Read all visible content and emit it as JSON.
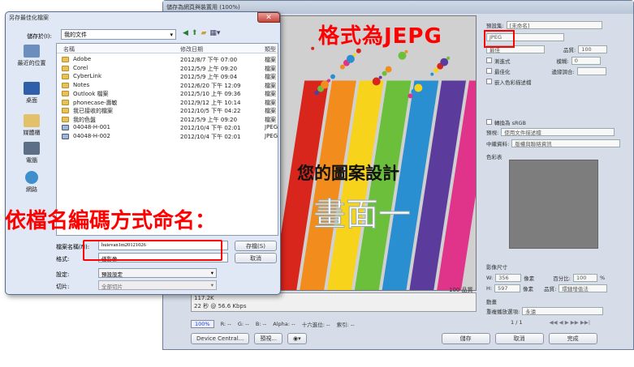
{
  "sfw_window": {
    "title": "儲存為網頁與裝置用 (100%)",
    "artwork_line1": "您的圖案設計",
    "artwork_line2": "畫面一",
    "preview_size": "100 品質",
    "info_lines": [
      "117.2K",
      "22 秒 @ 56.6 Kbps"
    ],
    "zoom": "100%",
    "status": [
      "R: --",
      "G: --",
      "B: --",
      "Alpha: --",
      "十六進位: --",
      "索引: --"
    ],
    "buttons": {
      "device_central": "Device Central...",
      "preview": "預視...",
      "save": "儲存",
      "cancel": "取消",
      "done": "完成"
    }
  },
  "panel": {
    "preset_label": "預設集:",
    "preset_value": "[未命名]",
    "format_value": "JPEG",
    "quality_mode": "最佳",
    "quality_label": "品質:",
    "quality_value": "100",
    "progressive": "漸進式",
    "blur_label": "模糊:",
    "blur_value": "0",
    "optimized": "最佳化",
    "matte_label": "邊緣調合:",
    "embed_profile": "嵌入色彩描述檔",
    "convert_srgb": "轉換為 sRGB",
    "preview_label": "預視:",
    "preview_value": "使用文件描述檔",
    "metadata_label": "中繼資料:",
    "metadata_value": "版權與聯絡資訊",
    "color_table": "色彩表",
    "image_size": "影像尺寸",
    "w_label": "W:",
    "w_value": "356",
    "h_label": "H:",
    "h_value": "597",
    "unit": "像素",
    "percent_label": "百分比:",
    "percent_value": "100",
    "percent_unit": "%",
    "resample_label": "品質:",
    "resample_value": "環鏈增值法",
    "animation": "動畫",
    "loop_label": "重複播放選項:",
    "loop_value": "永遠",
    "frame": "1 / 1"
  },
  "annotations": {
    "format": "格式為JEPG",
    "naming": "依檔名編碼方式命名："
  },
  "dialog": {
    "title": "另存最佳化檔案",
    "close": "✕",
    "lookin_label": "儲存於(I):",
    "lookin_value": "我的文件",
    "places": [
      "最近的位置",
      "桌面",
      "媒體櫃",
      "電腦",
      "網路"
    ],
    "columns": {
      "name": "名稱",
      "modified": "修改日期",
      "type": "類型"
    },
    "files": [
      {
        "name": "Adobe",
        "date": "2012/8/7 下午 07:00",
        "type": "檔案",
        "kind": "folder"
      },
      {
        "name": "Corel",
        "date": "2012/5/9 上午 09:20",
        "type": "檔案",
        "kind": "folder"
      },
      {
        "name": "CyberLink",
        "date": "2012/5/9 上午 09:04",
        "type": "檔案",
        "kind": "folder"
      },
      {
        "name": "Notes",
        "date": "2012/6/20 下午 12:09",
        "type": "檔案",
        "kind": "folder"
      },
      {
        "name": "Outlook 檔案",
        "date": "2012/5/10 上午 09:36",
        "type": "檔案",
        "kind": "folder"
      },
      {
        "name": "phonecase-壽敏",
        "date": "2012/9/12 上午 10:14",
        "type": "檔案",
        "kind": "folder"
      },
      {
        "name": "我已接收的檔案",
        "date": "2012/10/5 下午 04:22",
        "type": "檔案",
        "kind": "folder"
      },
      {
        "name": "我的色盤",
        "date": "2012/5/9 上午 09:20",
        "type": "檔案",
        "kind": "folder"
      },
      {
        "name": "04048-H-001",
        "date": "2012/10/4 下午 02:01",
        "type": "JPEG",
        "kind": "img"
      },
      {
        "name": "04048-H-002",
        "date": "2012/10/4 下午 02:01",
        "type": "JPEG",
        "kind": "img"
      }
    ],
    "filename_label": "檔案名稱(N):",
    "filename_value": "huievan1m20121026",
    "format_label": "格式:",
    "format_value": "僅影像",
    "save_button": "存檔(S)",
    "cancel_button": "取消",
    "settings_label": "設定:",
    "settings_value": "預設設定",
    "slices_label": "切片:",
    "slices_value": "全部切片"
  },
  "colors": {
    "annotation_red": "#ff0000",
    "stripes": [
      "#d9261c",
      "#f28c1c",
      "#f7d31c",
      "#6cbf3a",
      "#2a8fd0",
      "#5b3b9b",
      "#e0338a"
    ]
  }
}
